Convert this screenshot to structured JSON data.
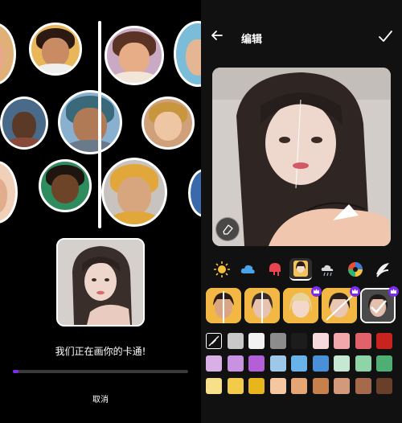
{
  "left_panel": {
    "progress_text": "我们正在画你的卡通!",
    "progress_fraction": 0.03,
    "cancel_label": "取消",
    "colors": {
      "accent": "#7a2cf0"
    }
  },
  "editor": {
    "title": "编辑",
    "icons": {
      "back": "arrow-left-icon",
      "confirm": "check-icon",
      "eraser": "eraser-icon"
    },
    "tools": [
      "sun-icon",
      "cloud-icon",
      "drip-icon",
      "portrait-icon",
      "weather-icon",
      "color-wheel-icon",
      "brush-icon"
    ],
    "active_tool": "portrait-icon",
    "style_thumbs": [
      {
        "name": "style-1",
        "premium": false
      },
      {
        "name": "style-2",
        "premium": false
      },
      {
        "name": "style-3",
        "premium": true
      },
      {
        "name": "style-4",
        "premium": true
      },
      {
        "name": "style-5",
        "premium": true,
        "selected": true
      }
    ],
    "palette": [
      [
        "none",
        "#c8c8c8",
        "#f2f2f2",
        "#8c8c8c",
        "#1c1c1c",
        "#f6d9da",
        "#f2a7aa",
        "#e2626b",
        "#c8231f"
      ],
      [
        "#d8b0e6",
        "#c793e0",
        "#b25fd8",
        "#9ec8ea",
        "#6ab3ea",
        "#4a90d9",
        "#c6e8d2",
        "#8fd3a8",
        "#4fae73"
      ],
      [
        "#f6e08a",
        "#f3cb4a",
        "#e9b51c",
        "#f3c7a0",
        "#e5a574",
        "#c77f4b",
        "#d29a7a",
        "#a56a4c",
        "#6a3f2a"
      ]
    ]
  }
}
